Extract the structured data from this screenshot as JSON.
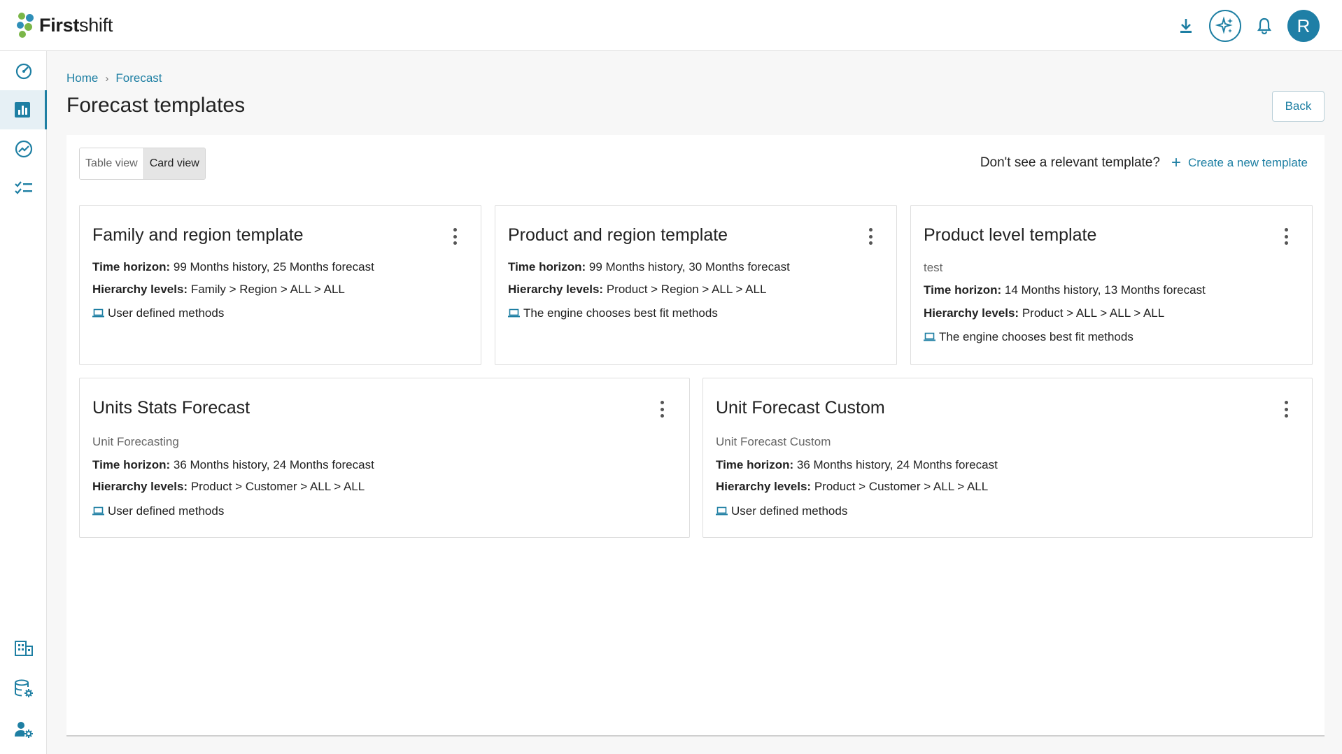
{
  "app": {
    "brand_bold": "First",
    "brand_light": "shift",
    "user_initial": "R",
    "accent": "#1e7fa3"
  },
  "icons": {
    "top": [
      "download-icon",
      "sparkle-icon",
      "bell-icon"
    ],
    "sidebar": [
      "dashboard-gauge-icon",
      "bar-chart-icon",
      "trend-icon",
      "checklist-icon",
      "building-icon",
      "database-settings-icon",
      "user-settings-icon"
    ],
    "method": "laptop-icon",
    "create": "plus-icon",
    "card_menu": "more-vertical-icon"
  },
  "breadcrumb": {
    "home": "Home",
    "sep": "›",
    "current": "Forecast"
  },
  "page": {
    "title": "Forecast templates",
    "back_label": "Back"
  },
  "views": {
    "table": "Table view",
    "card": "Card view",
    "selected": "Card view"
  },
  "prompt": {
    "text": "Don't see a relevant template?",
    "create_label": "Create a new template"
  },
  "labels": {
    "time_horizon": "Time horizon:",
    "hierarchy_levels": "Hierarchy levels:"
  },
  "cards": [
    {
      "title": "Family and region template",
      "subtitle": "",
      "time_horizon": "99 Months history, 25 Months forecast",
      "hierarchy": "Family > Region > ALL > ALL",
      "method": "User defined methods"
    },
    {
      "title": "Product and region template",
      "subtitle": "",
      "time_horizon": "99 Months history, 30 Months forecast",
      "hierarchy": "Product > Region > ALL > ALL",
      "method": "The engine chooses best fit methods"
    },
    {
      "title": "Product level template",
      "subtitle": "test",
      "time_horizon": "14 Months history, 13 Months forecast",
      "hierarchy": "Product > ALL > ALL > ALL",
      "method": "The engine chooses best fit methods"
    },
    {
      "title": "Units Stats Forecast",
      "subtitle": "Unit Forecasting",
      "time_horizon": "36 Months history, 24 Months forecast",
      "hierarchy": "Product > Customer > ALL > ALL",
      "method": "User defined methods"
    },
    {
      "title": "Unit Forecast Custom",
      "subtitle": "Unit Forecast Custom",
      "time_horizon": "36 Months history, 24 Months forecast",
      "hierarchy": "Product > Customer > ALL > ALL",
      "method": "User defined methods"
    }
  ]
}
